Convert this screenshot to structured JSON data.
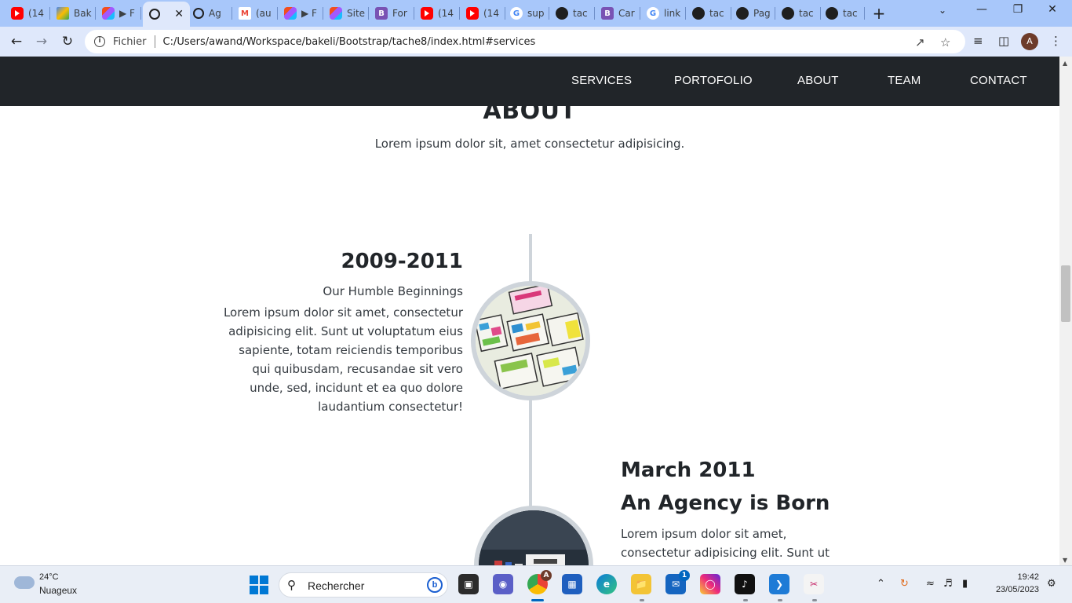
{
  "browser": {
    "tabs": [
      {
        "title": "(14",
        "favicon": "youtube-icon"
      },
      {
        "title": "Bak",
        "favicon": "drive-icon"
      },
      {
        "title": "▶ F",
        "favicon": "figma-icon"
      },
      {
        "title": "",
        "favicon": "globe-icon",
        "active": true
      },
      {
        "title": "Ag",
        "favicon": "globe-icon"
      },
      {
        "title": "(au",
        "favicon": "gmail-icon"
      },
      {
        "title": "▶ F",
        "favicon": "figma-icon"
      },
      {
        "title": "Site",
        "favicon": "figma-icon"
      },
      {
        "title": "For",
        "favicon": "bootstrap-icon"
      },
      {
        "title": "(14",
        "favicon": "youtube-icon"
      },
      {
        "title": "(14",
        "favicon": "youtube-icon"
      },
      {
        "title": "sup",
        "favicon": "google-icon"
      },
      {
        "title": "tac",
        "favicon": "web-icon"
      },
      {
        "title": "Car",
        "favicon": "bootstrap-icon"
      },
      {
        "title": "link",
        "favicon": "google-icon"
      },
      {
        "title": "tac",
        "favicon": "web-icon"
      },
      {
        "title": "Pag",
        "favicon": "github-icon"
      },
      {
        "title": "tac",
        "favicon": "web-icon"
      },
      {
        "title": "tac",
        "favicon": "web-icon"
      }
    ],
    "omnibox": {
      "scheme_label": "Fichier",
      "url": "C:/Users/awand/Workspace/bakeli/Bootstrap/tache8/index.html#services"
    },
    "profile_initial": "A"
  },
  "page": {
    "nav": {
      "links": [
        "SERVICES",
        "PORTOFOLIO",
        "ABOUT",
        "TEAM",
        "CONTACT"
      ]
    },
    "about": {
      "title": "ABOUT",
      "subtitle": "Lorem ipsum dolor sit, amet consectetur adipisicing."
    },
    "timeline": [
      {
        "year": "2009-2011",
        "subtitle": "Our Humble Beginnings",
        "body": "Lorem ipsum dolor sit amet, consectetur adipisicing elit. Sunt ut voluptatum eius sapiente, totam reiciendis temporibus qui quibusdam, recusandae sit vero unde, sed, incidunt et ea quo dolore laudantium consectetur!",
        "image": "sketches-photo"
      },
      {
        "year": "March 2011",
        "subtitle": "An Agency is Born",
        "body": "Lorem ipsum dolor sit amet, consectetur adipisicing elit. Sunt ut voluptatum eius",
        "image": "desk-photo"
      }
    ]
  },
  "taskbar": {
    "weather": {
      "temp": "24°C",
      "desc": "Nuageux"
    },
    "search_label": "Rechercher",
    "mail_badge": "1",
    "chrome_badge": "A",
    "clock": {
      "time": "19:42",
      "date": "23/05/2023"
    }
  }
}
